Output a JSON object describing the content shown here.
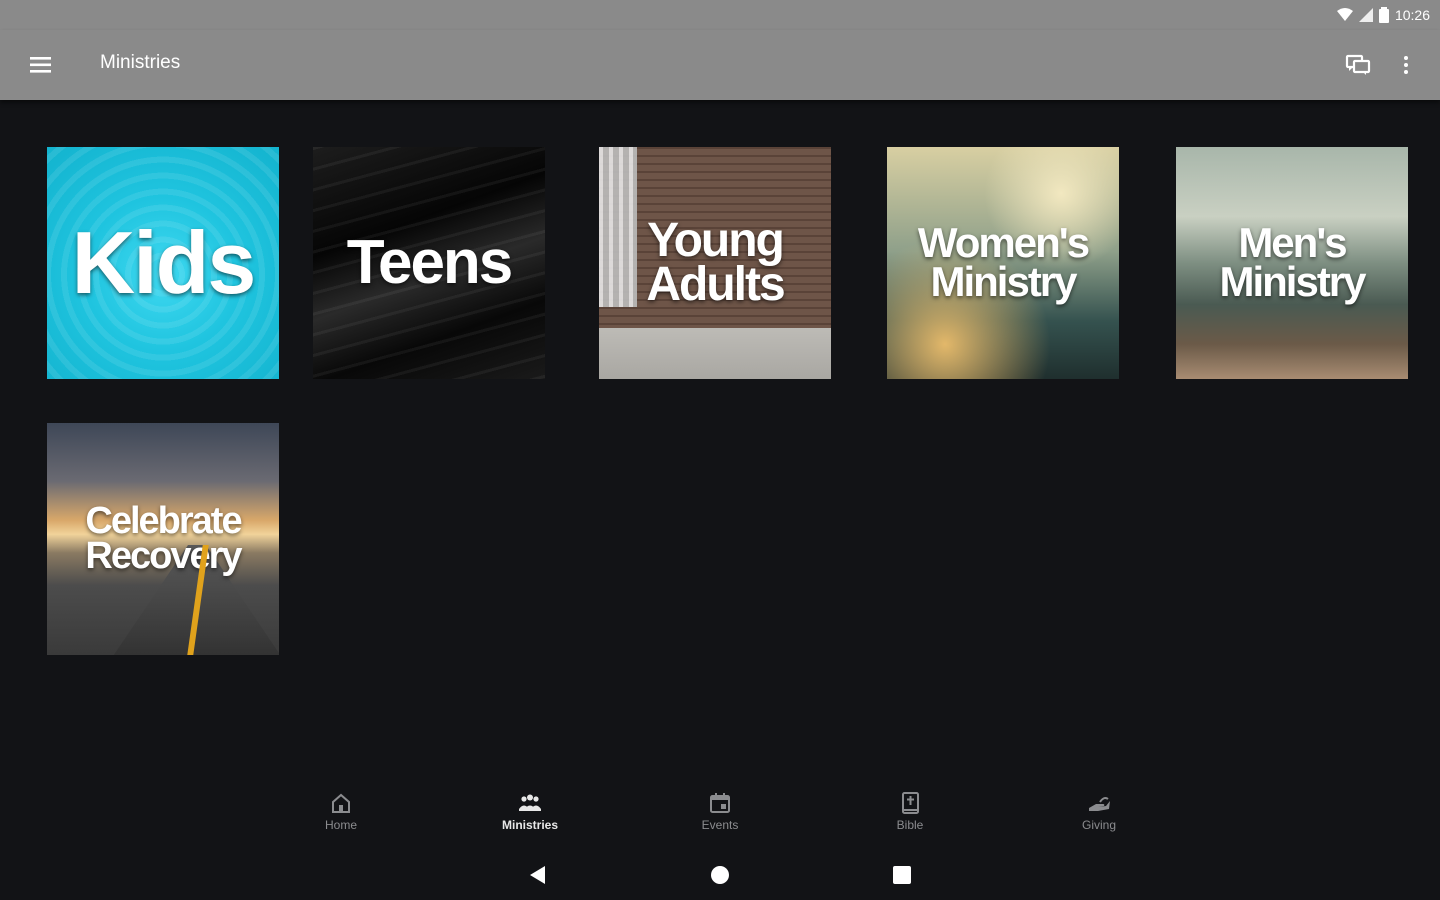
{
  "status_bar": {
    "time": "10:26",
    "icons": [
      "wifi-icon",
      "signal-icon",
      "battery-icon"
    ]
  },
  "app_bar": {
    "title": "Ministries",
    "menu_icon": "hamburger-menu-icon",
    "actions": [
      "chat-icon",
      "more-vertical-icon"
    ]
  },
  "ministries": [
    {
      "label": "Kids",
      "line1": "Kids",
      "line2": ""
    },
    {
      "label": "Teens",
      "line1": "Teens",
      "line2": ""
    },
    {
      "label": "Young Adults",
      "line1": "Young",
      "line2": "Adults"
    },
    {
      "label": "Women's Ministry",
      "line1": "Women's",
      "line2": "Ministry"
    },
    {
      "label": "Men's Ministry",
      "line1": "Men's",
      "line2": "Ministry"
    },
    {
      "label": "Celebrate Recovery",
      "line1": "Celebrate",
      "line2": "Recovery"
    }
  ],
  "bottom_nav": {
    "active": "Ministries",
    "items": [
      {
        "label": "Home",
        "icon": "home-icon"
      },
      {
        "label": "Ministries",
        "icon": "people-icon"
      },
      {
        "label": "Events",
        "icon": "calendar-icon"
      },
      {
        "label": "Bible",
        "icon": "bible-icon"
      },
      {
        "label": "Giving",
        "icon": "giving-hand-icon"
      }
    ]
  },
  "system_nav": [
    "back-icon",
    "home-circle-icon",
    "recents-icon"
  ],
  "colors": {
    "background": "#121316",
    "app_bar": "#8a8a8a",
    "nav_inactive": "#8b8c8f",
    "nav_active": "#e8e8e8"
  }
}
